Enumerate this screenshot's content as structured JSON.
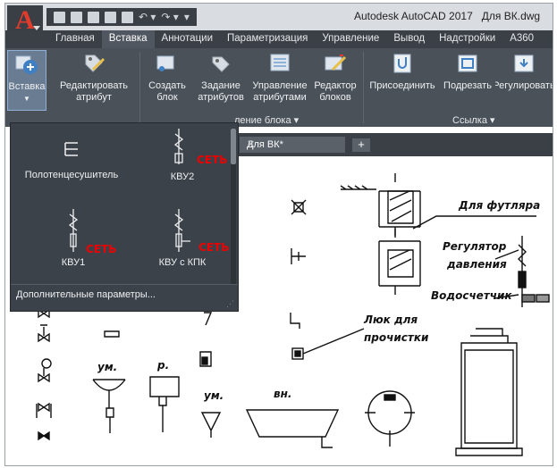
{
  "title_bar": {
    "app_title": "Autodesk AutoCAD 2017",
    "file_name": "Для ВК.dwg",
    "app_menu_letter": "A"
  },
  "ribbon_tabs": [
    "Главная",
    "Вставка",
    "Аннотации",
    "Параметризация",
    "Управление",
    "Вывод",
    "Надстройки",
    "A360"
  ],
  "active_tab": "Вставка",
  "ribbon": {
    "insert": "Вставка",
    "edit_attribute_1": "Редактировать",
    "edit_attribute_2": "атрибут",
    "create_block_1": "Создать",
    "create_block_2": "блок",
    "define_attributes_1": "Задание",
    "define_attributes_2": "атрибутов",
    "manage_attributes_1": "Управление",
    "manage_attributes_2": "атрибутами",
    "block_editor_1": "Редактор",
    "block_editor_2": "блоков",
    "attach": "Присоединить",
    "clip": "Подрезать",
    "adjust": "Регулировать",
    "group_block_definition": "ление блока",
    "group_reference": "Ссылка"
  },
  "document_tab": {
    "label": "Для ВК*"
  },
  "block_gallery": {
    "items": [
      {
        "label": "Полотенцесушитель"
      },
      {
        "label": "КВУ2",
        "tag": "СЕТЬ"
      },
      {
        "label": "КВУ1",
        "tag": "СЕТЬ"
      },
      {
        "label": "КВУ с КПК",
        "tag": "СЕТЬ"
      }
    ],
    "more_options": "Дополнительные параметры..."
  },
  "drawing_labels": {
    "sleeve": "Для футляра",
    "regulator_1": "Регулятор",
    "regulator_2": "давления",
    "meter": "Водосчетчик",
    "hatch_1": "Люк для",
    "hatch_2": "прочистки",
    "sink_1": "ум.",
    "sink_2": "р.",
    "sink_3": "ум.",
    "bath": "вн."
  },
  "colors": {
    "accent_red": "#e23b2c",
    "ribbon_dark": "#3b4047",
    "ribbon_panel": "#4a5159",
    "gallery_bg": "#3c4249",
    "tag_red": "#e00000"
  }
}
